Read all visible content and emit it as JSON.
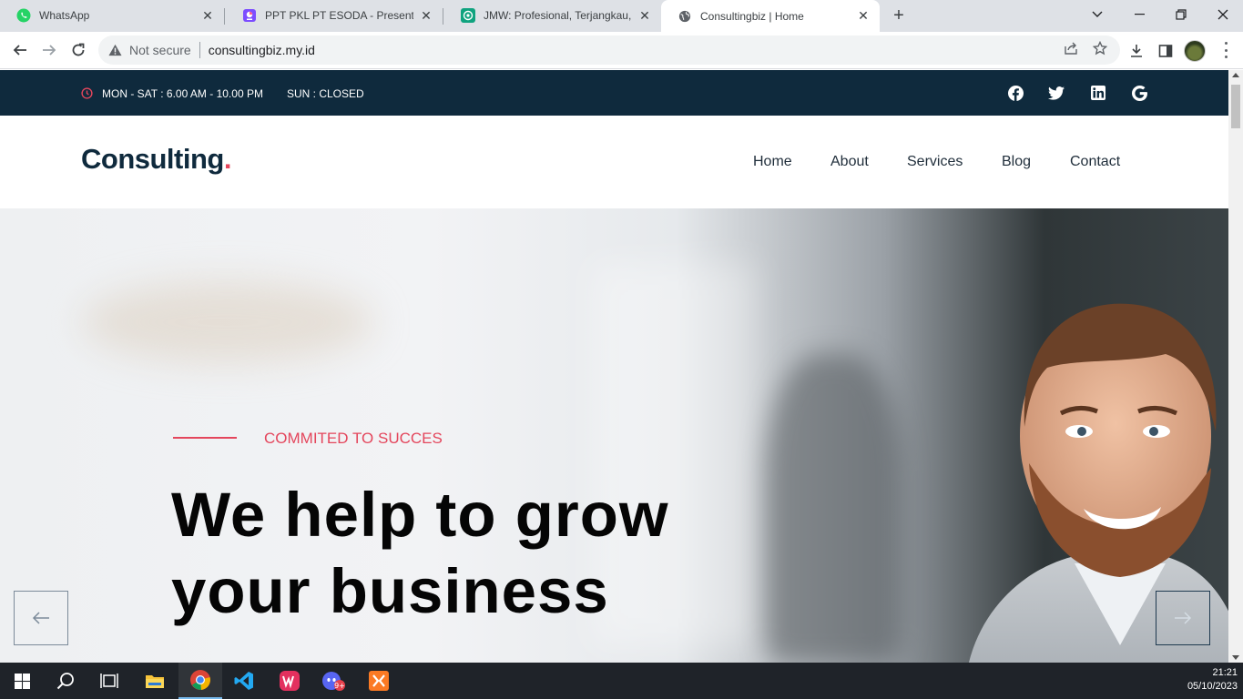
{
  "browser": {
    "tabs": [
      {
        "title": "WhatsApp",
        "icon": "whatsapp-icon",
        "active": false
      },
      {
        "title": "PPT PKL PT ESODA - Presentasi",
        "icon": "slides-icon",
        "active": false
      },
      {
        "title": "JMW: Profesional, Terjangkau, SE",
        "icon": "openai-icon",
        "active": false
      },
      {
        "title": "Consultingbiz | Home",
        "icon": "globe-icon",
        "active": true
      }
    ],
    "security_label": "Not secure",
    "url": "consultingbiz.my.id"
  },
  "site": {
    "topbar": {
      "hours_weekdays": "MON - SAT : 6.00 AM - 10.00 PM",
      "hours_sunday": "SUN : CLOSED",
      "social_icons": [
        "facebook-icon",
        "twitter-icon",
        "linkedin-icon",
        "google-icon"
      ]
    },
    "logo": {
      "text": "Consulting",
      "dot": "."
    },
    "nav": [
      "Home",
      "About",
      "Services",
      "Blog",
      "Contact"
    ],
    "hero": {
      "eyebrow": "COMMITED TO SUCCES",
      "headline_line1": "We help to grow",
      "headline_line2": "your business"
    }
  },
  "taskbar": {
    "apps": [
      "windows-start-icon",
      "search-icon",
      "task-view-icon",
      "file-explorer-icon",
      "chrome-icon",
      "vscode-icon",
      "wps-office-icon",
      "discord-icon",
      "xampp-icon"
    ],
    "time": "21:21",
    "date": "05/10/2023"
  },
  "colors": {
    "topbar_bg": "#0f2a3d",
    "accent": "#e4465c",
    "logo_text": "#0f2a3d"
  }
}
